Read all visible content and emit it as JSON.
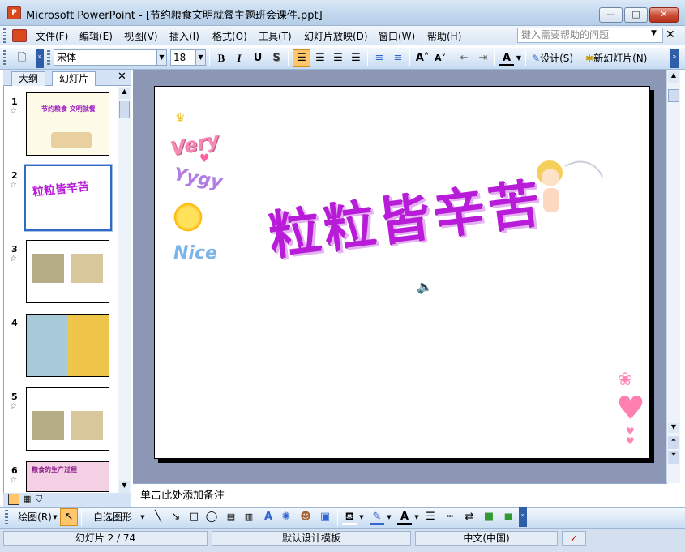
{
  "window": {
    "title": "Microsoft PowerPoint - [节约粮食文明就餐主题班会课件.ppt]",
    "min": "—",
    "max": "□",
    "close": "✕"
  },
  "menu": {
    "items": [
      "文件(F)",
      "编辑(E)",
      "视图(V)",
      "插入(I)",
      "格式(O)",
      "工具(T)",
      "幻灯片放映(D)",
      "窗口(W)",
      "帮助(H)"
    ],
    "help_placeholder": "键入需要帮助的问题",
    "close": "✕"
  },
  "toolbar": {
    "font": "宋体",
    "size": "18",
    "bold": "B",
    "italic": "I",
    "underline": "U",
    "shadow": "S",
    "design": "设计(S)",
    "new_slide": "新幻灯片(N)"
  },
  "outline_pane": {
    "tab_outline": "大纲",
    "tab_slides": "幻灯片",
    "close": "✕",
    "thumbnails": [
      {
        "num": "1",
        "title": "节约粮食 文明就餐"
      },
      {
        "num": "2",
        "title": "粒粒皆辛苦"
      },
      {
        "num": "3",
        "title": ""
      },
      {
        "num": "4",
        "title": ""
      },
      {
        "num": "5",
        "title": ""
      },
      {
        "num": "6",
        "title": "粮食的生产过程"
      }
    ]
  },
  "slide": {
    "title": "粒粒皆辛苦",
    "stickers": [
      "Very",
      "Yygy",
      "Nice"
    ]
  },
  "notes": {
    "placeholder": "单击此处添加备注"
  },
  "drawing_toolbar": {
    "draw": "绘图(R)",
    "autoshapes": "自选图形(U)"
  },
  "status": {
    "slide": "幻灯片 2 / 74",
    "template": "默认设计模板",
    "language": "中文(中国)"
  },
  "colors": {
    "accent": "#316ac5",
    "title_purple": "#b91cd8",
    "editor_bg": "#8c97b5"
  }
}
